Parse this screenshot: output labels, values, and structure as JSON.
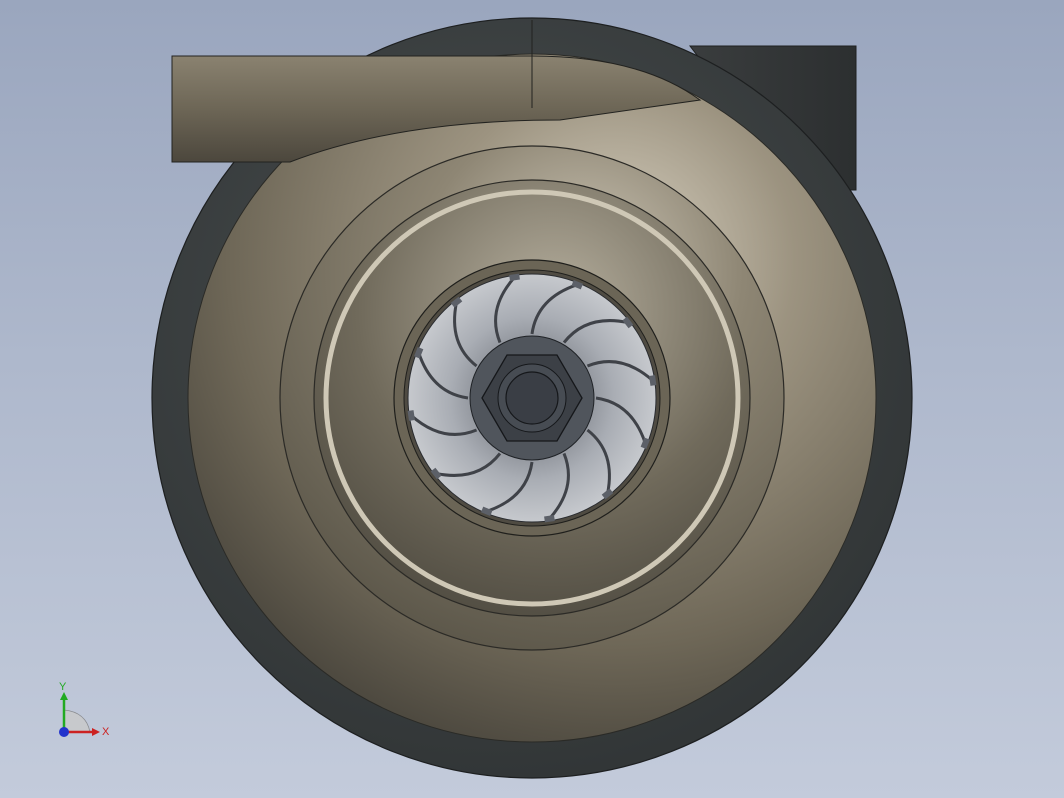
{
  "viewport": {
    "background_top": "#9aa6be",
    "background_bottom": "#c3cbdb",
    "model": "turbocharger-compressor-housing",
    "impeller_blade_count": 12
  },
  "colors": {
    "housing": "#7a7262",
    "housing_highlight": "#d6cfbf",
    "housing_shadow": "#3d3a33",
    "back_plate": "#3b3f40",
    "impeller": "#c9cbcf",
    "nut": "#3c4046",
    "axis_x": "#cc2222",
    "axis_y": "#22aa22",
    "axis_z": "#2233cc"
  },
  "triad": {
    "x_label": "X",
    "y_label": "Y"
  }
}
